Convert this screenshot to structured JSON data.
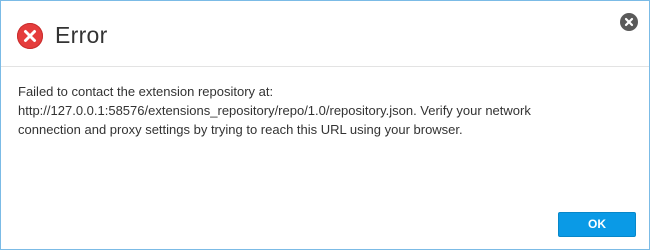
{
  "dialog": {
    "title": "Error",
    "icon": "error-icon",
    "close_icon": "close-icon",
    "message_lines": [
      "Failed to contact the extension repository at:",
      "http://127.0.0.1:58576/extensions_repository/repo/1.0/repository.json.  Verify your network",
      "connection and proxy settings by trying to reach this URL using your browser."
    ],
    "ok_label": "OK"
  },
  "colors": {
    "error_red": "#e53d3d",
    "button_blue": "#0a9ae6",
    "border_blue": "#7bbbe6"
  }
}
